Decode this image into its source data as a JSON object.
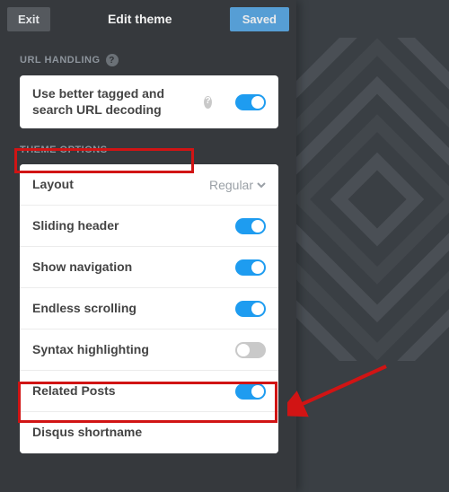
{
  "topbar": {
    "exit": "Exit",
    "title": "Edit theme",
    "saved": "Saved"
  },
  "urlHandling": {
    "header": "URL HANDLING",
    "row": {
      "label": "Use better tagged and search URL decoding",
      "on": true
    }
  },
  "themeOptions": {
    "header": "THEME OPTIONS",
    "layout": {
      "label": "Layout",
      "value": "Regular"
    },
    "rows": [
      {
        "label": "Sliding header",
        "on": true
      },
      {
        "label": "Show navigation",
        "on": true
      },
      {
        "label": "Endless scrolling",
        "on": true
      },
      {
        "label": "Syntax highlighting",
        "on": false
      },
      {
        "label": "Related Posts",
        "on": true
      },
      {
        "label": "Disqus shortname",
        "on": null
      }
    ]
  }
}
